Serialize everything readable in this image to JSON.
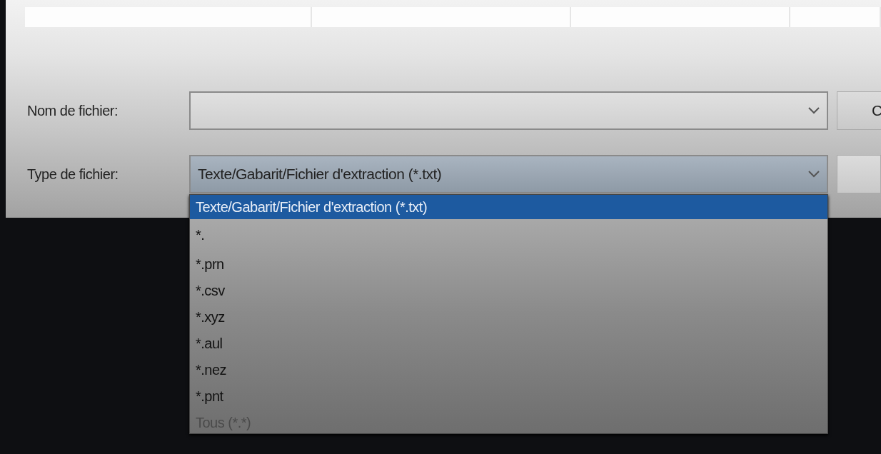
{
  "file_name": {
    "label": "Nom de fichier:"
  },
  "file_type": {
    "label": "Type de fichier:",
    "value": "Texte/Gabarit/Fichier d'extraction (*.txt)",
    "expanded": true,
    "options": [
      {
        "label": "Texte/Gabarit/Fichier d'extraction (*.txt)",
        "selected": true
      },
      {
        "label": "*.",
        "selected": false
      },
      {
        "label": "*.prn",
        "selected": false
      },
      {
        "label": "*.csv",
        "selected": false
      },
      {
        "label": "*.xyz",
        "selected": false
      },
      {
        "label": "*.aul",
        "selected": false
      },
      {
        "label": "*.nez",
        "selected": false
      },
      {
        "label": "*.pnt",
        "selected": false
      },
      {
        "label": "Tous (*.*)",
        "selected": false
      }
    ]
  },
  "buttons": [
    {
      "label": "C"
    }
  ]
}
